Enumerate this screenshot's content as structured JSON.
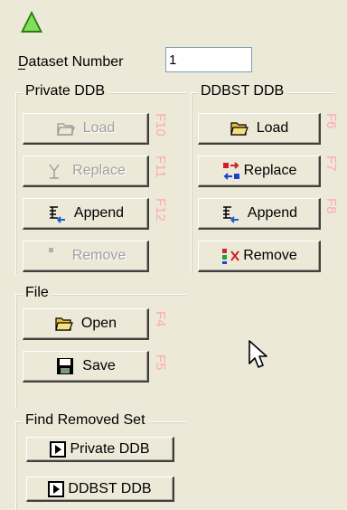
{
  "dataset": {
    "label": "Dataset Number",
    "value": "1"
  },
  "private_group": {
    "title": "Private DDB"
  },
  "ddbst_group": {
    "title": "DDBST DDB"
  },
  "file_group": {
    "title": "File"
  },
  "find_group": {
    "title": "Find Removed Set"
  },
  "private_buttons": {
    "load": "Load",
    "replace": "Replace",
    "append": "Append",
    "remove": "Remove"
  },
  "private_keys": {
    "load": "F10",
    "replace": "F11",
    "append": "F12"
  },
  "ddbst_buttons": {
    "load": "Load",
    "replace": "Replace",
    "append": "Append",
    "remove": "Remove"
  },
  "ddbst_keys": {
    "load": "F6",
    "replace": "F7",
    "append": "F8"
  },
  "file_buttons": {
    "open": "Open",
    "save": "Save"
  },
  "file_keys": {
    "open": "F4",
    "save": "F5"
  },
  "find_buttons": {
    "private": "Private DDB",
    "ddbst": "DDBST DDB"
  },
  "colors": {
    "background": "#ece9d8",
    "fkey": "#ffa8b5",
    "disabled": "#a0a0a0"
  }
}
